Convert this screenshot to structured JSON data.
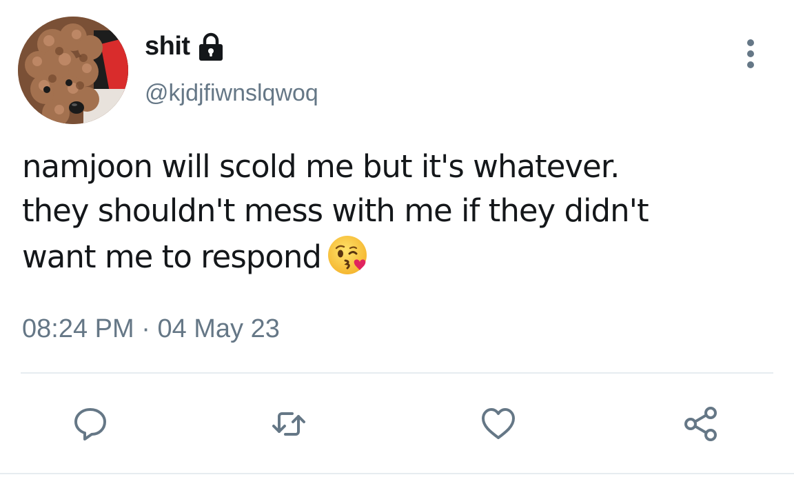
{
  "tweet": {
    "display_name": "shit",
    "protected_icon": "lock-icon",
    "username": "@kjdjfiwnslqwoq",
    "text_lines": [
      "namjoon will scold me but it's whatever.",
      "they shouldn't mess with me if they didn't",
      "want me to respond"
    ],
    "emoji": "face-throwing-kiss-emoji",
    "time": "08:24 PM",
    "separator": "·",
    "date": "04 May 23"
  },
  "actions": [
    {
      "name": "reply",
      "icon": "reply-icon"
    },
    {
      "name": "retweet",
      "icon": "retweet-icon"
    },
    {
      "name": "like",
      "icon": "heart-icon"
    },
    {
      "name": "share",
      "icon": "share-icon"
    }
  ],
  "colors": {
    "text": "#14171a",
    "secondary": "#657786",
    "divider": "#e6ecf0"
  }
}
